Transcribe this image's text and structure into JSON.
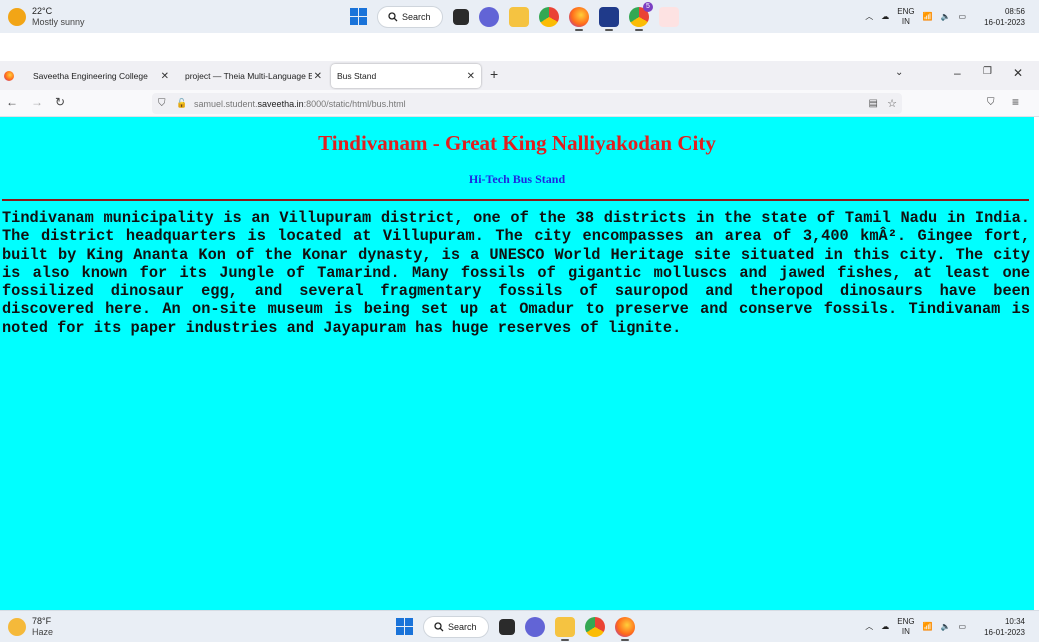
{
  "top_taskbar": {
    "weather_temp": "22°C",
    "weather_desc": "Mostly sunny",
    "search_label": "Search",
    "lang_line1": "ENG",
    "lang_line2": "IN",
    "time": "08:56",
    "date": "16-01-2023",
    "notification_badge": "5"
  },
  "browser": {
    "tabs": [
      {
        "label": "Saveetha Engineering College"
      },
      {
        "label": "project — Theia Multi-Language Ex"
      },
      {
        "label": "Bus Stand"
      }
    ],
    "url_prefix": "samuel.student.",
    "url_domain": "saveetha.in",
    "url_suffix": ":8000/static/html/bus.html"
  },
  "page": {
    "heading": "Tindivanam - Great King Nalliyakodan City",
    "subheading": "Hi-Tech Bus Stand",
    "paragraph": "Tindivanam municipality is an Villupuram district, one of the 38 districts in the state of Tamil Nadu in India. The district headquarters is located at Villupuram. The city encompasses an area of 3,400 kmÂ². Gingee fort, built by King Ananta Kon of the Konar dynasty, is a UNESCO World Heritage site situated in this city. The city is also known for its Jungle of Tamarind. Many fossils of gigantic molluscs and jawed fishes, at least one fossilized dinosaur egg, and several fragmentary fossils of sauropod and theropod dinosaurs have been discovered here. An on-site museum is being set up at Omadur to preserve and conserve fossils. Tindivanam is noted for its paper industries and Jayapuram has huge reserves of lignite.",
    "background_color": "#00ffff",
    "heading_color": "#e21f1f",
    "subheading_color": "#1d2ae0"
  },
  "bottom_taskbar": {
    "weather_temp": "78°F",
    "weather_desc": "Haze",
    "search_label": "Search",
    "lang_line1": "ENG",
    "lang_line2": "IN",
    "time": "10:34",
    "date": "16-01-2023"
  },
  "icons": [
    "windows-start-icon",
    "search-icon",
    "firefox-icon",
    "chrome-icon",
    "file-explorer-icon",
    "teams-icon",
    "wifi-icon",
    "volume-icon",
    "battery-icon"
  ]
}
